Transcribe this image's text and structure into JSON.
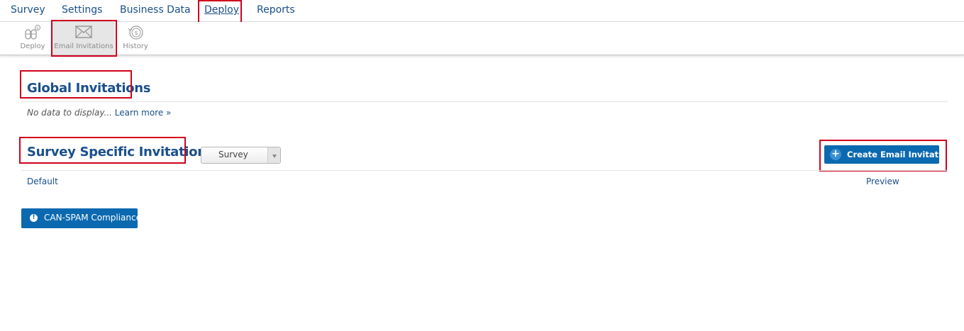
{
  "topnav": {
    "items": [
      "Survey",
      "Settings",
      "Business Data",
      "Deploy",
      "Reports"
    ],
    "active": "Deploy"
  },
  "toolbar": {
    "items": [
      {
        "label": "Deploy",
        "icon": "deploy-icon"
      },
      {
        "label": "Email Invitations",
        "icon": "envelope-icon"
      },
      {
        "label": "History",
        "icon": "history-icon"
      }
    ],
    "selected": "Email Invitations"
  },
  "global": {
    "title": "Global Invitations",
    "no_data": "No data to display...",
    "learn_more": "Learn more »"
  },
  "survey_specific": {
    "title": "Survey Specific Invitations",
    "filter_value": "Survey",
    "create_button": "Create Email Invitation",
    "row": {
      "name": "Default",
      "action": "Preview"
    }
  },
  "compliance_button": "CAN-SPAM Compliance",
  "colors": {
    "link": "#1a4f8b",
    "button": "#0b69b0",
    "highlight": "#d0021b"
  }
}
